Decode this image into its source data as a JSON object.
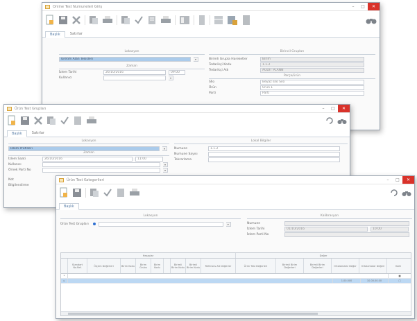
{
  "window_back": {
    "title": "Online Test Numuneleri Giriş",
    "tabs": [
      "Başlık",
      "Satırlar"
    ],
    "group_left": "Lokasyon",
    "group_mid": "Zaman",
    "group_right": "Birincil Grupları",
    "group_right2": "Parça/ürün",
    "location_value": "Üretim Alan Tesisleri",
    "date_label": "İzlem Tarihi",
    "date_value": "26/10/2016",
    "time_value": "09:00",
    "fields_left": [
      "Kullanıcı"
    ],
    "fields_right": [
      "Birimli Grupla Hareketler",
      "Tedarikçi Kodu",
      "Tedarikçi Adı"
    ],
    "values_right": [
      "Birim",
      "1.1.2",
      "AUDIT PLANN"
    ],
    "list_right": [
      "Sİlo",
      "Ürün",
      "Parti"
    ],
    "list_right_values": [
      "Beyaz silo Silo",
      "Ürün 1",
      "Parti"
    ]
  },
  "window_mid": {
    "title": "Ürün Test Grupları",
    "tabs": [
      "Başlık",
      "Satırlar"
    ],
    "group_left": "Lokasyon",
    "group_mid": "Zaman",
    "group_right": "Lokal Bilgiler",
    "location_value": "İzlem Profilleri",
    "rows_left": [
      "İzlem Saati",
      "Kullanıcı",
      "Örnek Parti No"
    ],
    "date_value": "26/10/2016",
    "time_value": "11:00",
    "rows_right": [
      "Numune",
      "Numune Sayısı",
      "Tekrarlama"
    ],
    "value_right": "1.1.2",
    "lower_label": [
      "Not",
      "Bilgilendirme"
    ]
  },
  "window_front": {
    "title": "Ürün Test Kategorileri",
    "tab": "Başlık",
    "group_left": "Lokasyon",
    "group_right": "Kalibrasyon",
    "field_left_label": "Ürün Test Grupları",
    "right_labels": [
      "Numune",
      "İzlem Tarihi",
      "İzlem Parti No"
    ],
    "date_value": "01/10/2016",
    "time_value": "10:00",
    "grid_group_left": "Hesaplar",
    "grid_group_right": "Değer",
    "columns_left": [
      "Standart No.Ref.",
      "Ölçüm Değerleri",
      "Birim Kodu",
      "Birim Grubu",
      "Birim Kodu",
      "",
      "Birimli Birim Kodu",
      "Birimli Birim Kodu",
      "Referans Alt Değerler"
    ],
    "columns_right": [
      "Ürün Test Değerleri",
      "Birimli Birim Değerleri",
      "Birimli Birim Değerleri",
      "Ortalamalar Değer",
      "Ortalamalar Değeri",
      "Kalit"
    ],
    "row_values": [
      "1.00.000",
      "10.00.00.00"
    ],
    "star": "*"
  },
  "icons": [
    "new-doc-icon",
    "save-icon",
    "delete-icon",
    "copy-icon",
    "print-icon",
    "copy-icon",
    "check-icon",
    "list-icon",
    "print-icon",
    "layout-icon",
    "view-icon",
    "grid-icon",
    "export-icon",
    "doc-icon",
    "binoculars-icon"
  ],
  "colors": {
    "accent": "#2d6fd1",
    "selection": "#aacbeb",
    "close": "#d9322a"
  }
}
